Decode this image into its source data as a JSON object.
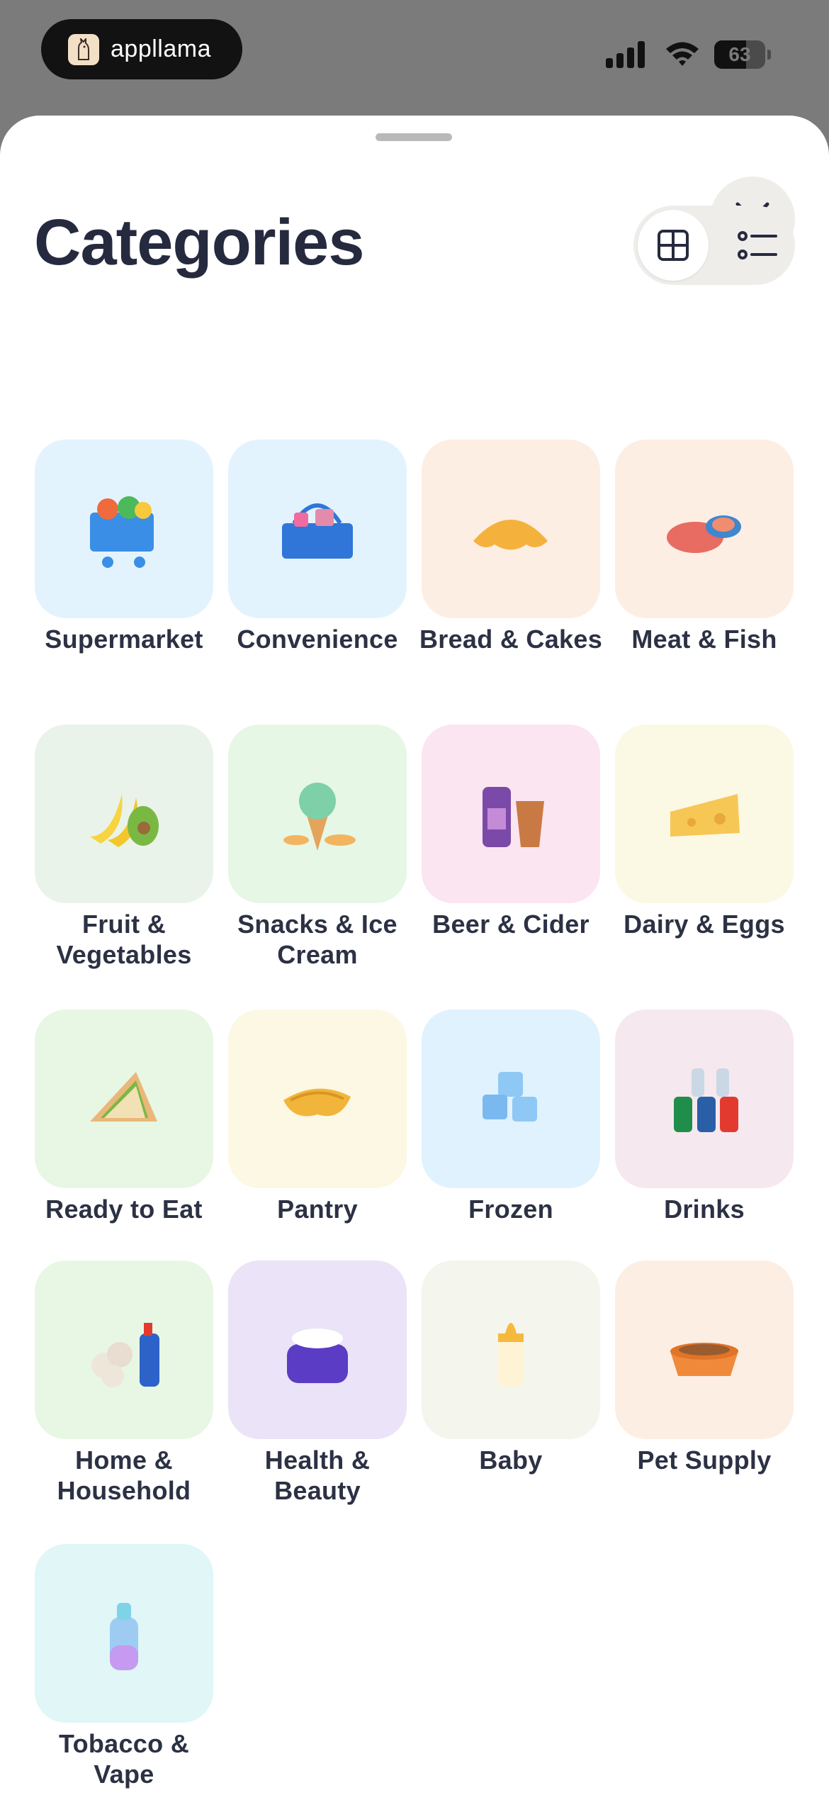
{
  "status_bar": {
    "brand_name": "appllama",
    "battery_percent": "63",
    "battery_level": 0.63
  },
  "header": {
    "title": "Categories"
  },
  "view_toggle": {
    "active": "grid"
  },
  "categories": [
    {
      "label": "Supermarket",
      "bg": "#e3f3fe",
      "icon": "shopping-cart-icon"
    },
    {
      "label": "Convenience",
      "bg": "#e3f3fe",
      "icon": "shopping-basket-icon"
    },
    {
      "label": "Bread & Cakes",
      "bg": "#fdeee3",
      "icon": "croissant-icon"
    },
    {
      "label": "Meat & Fish",
      "bg": "#fdeee3",
      "icon": "steak-icon"
    },
    {
      "label": "Fruit & Vegetables",
      "bg": "#eaf3e9",
      "icon": "banana-avocado-icon"
    },
    {
      "label": "Snacks & Ice Cream",
      "bg": "#e6f7e5",
      "icon": "ice-cream-icon"
    },
    {
      "label": "Beer & Cider",
      "bg": "#fbe5f1",
      "icon": "beer-can-icon"
    },
    {
      "label": "Dairy & Eggs",
      "bg": "#fbf8e4",
      "icon": "cheese-icon"
    },
    {
      "label": "Ready to Eat",
      "bg": "#e7f7e4",
      "icon": "sandwich-icon"
    },
    {
      "label": "Pantry",
      "bg": "#fcf8e4",
      "icon": "pasta-icon"
    },
    {
      "label": "Frozen",
      "bg": "#e0f2fe",
      "icon": "ice-cube-icon"
    },
    {
      "label": "Drinks",
      "bg": "#f6e8ef",
      "icon": "soda-bottles-icon"
    },
    {
      "label": "Home & Household",
      "bg": "#e7f7e4",
      "icon": "cleaning-supplies-icon"
    },
    {
      "label": "Health & Beauty",
      "bg": "#ebe3f7",
      "icon": "cream-jar-icon"
    },
    {
      "label": "Baby",
      "bg": "#f4f5ec",
      "icon": "baby-bottle-icon"
    },
    {
      "label": "Pet Supply",
      "bg": "#fdeee3",
      "icon": "pet-bowl-icon"
    },
    {
      "label": "Tobacco & Vape",
      "bg": "#e0f6f7",
      "icon": "vape-icon"
    }
  ]
}
